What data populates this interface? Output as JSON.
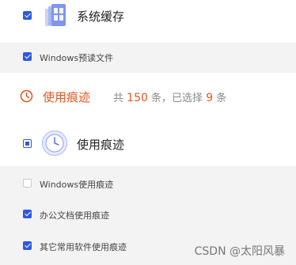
{
  "cache_section": {
    "title": "系统缓存",
    "icon": "windows-cache-icon",
    "items": [
      {
        "label": "Windows预读文件",
        "checked": true
      }
    ]
  },
  "summary": {
    "title": "使用痕迹",
    "icon": "clock-icon",
    "prefix": "共",
    "total": "150",
    "mid": "条，已选择",
    "selected": "9",
    "suffix": "条",
    "accent_color": "#e8541e"
  },
  "traces_section": {
    "title": "使用痕迹",
    "icon": "clock-badge-icon",
    "items": [
      {
        "label": "Windows使用痕迹",
        "checked": false
      },
      {
        "label": "办公文档使用痕迹",
        "checked": true
      },
      {
        "label": "其它常用软件使用痕迹",
        "checked": true
      }
    ]
  },
  "watermark": "CSDN @太阳风暴",
  "colors": {
    "checkbox": "#2f5ae0",
    "band": "#f3f3f4"
  }
}
